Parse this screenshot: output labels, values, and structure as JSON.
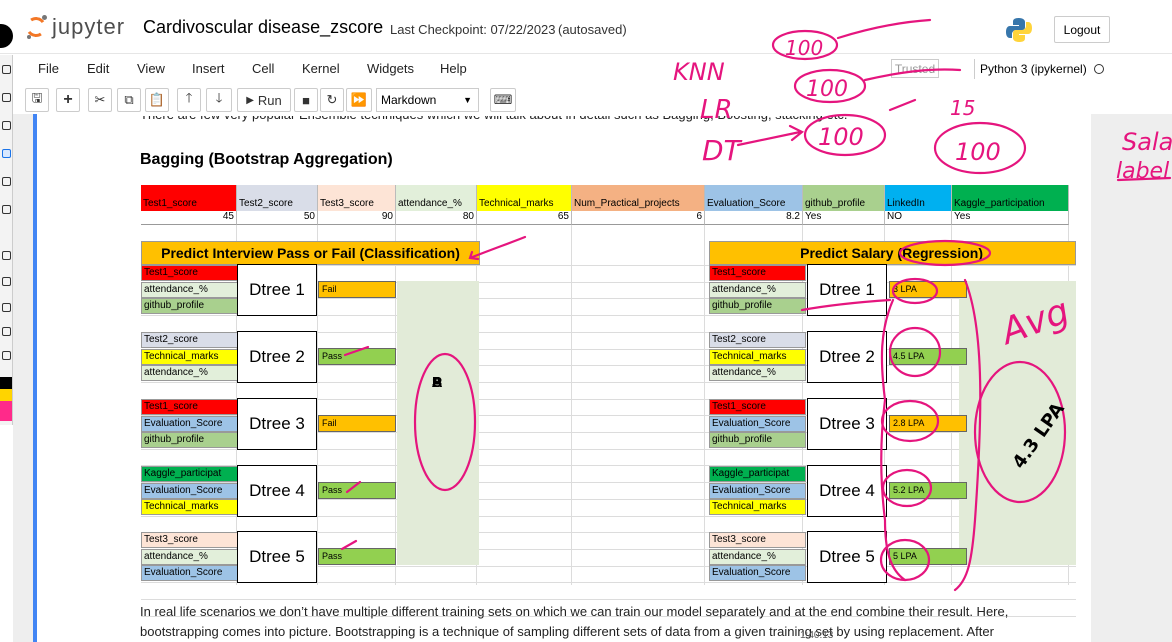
{
  "header": {
    "logo_text": "jupyter",
    "notebook_title": "Cardivoscular disease_zscore",
    "checkpoint": "Last Checkpoint: 07/22/2023",
    "autosave": "(autosaved)",
    "logout": "Logout"
  },
  "menu": [
    "File",
    "Edit",
    "View",
    "Insert",
    "Cell",
    "Kernel",
    "Widgets",
    "Help"
  ],
  "trusted": "Trusted",
  "kernel": "Python 3 (ipykernel)",
  "toolbar": {
    "run": "Run",
    "cell_type": "Markdown"
  },
  "content": {
    "intro": "There are few very popular Ensemble techniques which we will talk about in detail such as Bagging, Boosting, stacking etc.",
    "heading": "Bagging (Bootstrap Aggregation)",
    "para1": "In real life scenarios we don’t have multiple different training sets on which we can train our model separately and at the end combine their result. Here,",
    "para2": "bootstrapping comes into picture. Bootstrapping is a technique of sampling different sets of data from a given training set by using replacement. After"
  },
  "table": {
    "headers": [
      {
        "label": "Test1_score",
        "color": "#ff0000"
      },
      {
        "label": "Test2_score",
        "color": "#d9dde8"
      },
      {
        "label": "Test3_score",
        "color": "#fde4d6"
      },
      {
        "label": "attendance_%",
        "color": "#e2efda"
      },
      {
        "label": "Technical_marks",
        "color": "#ffff00"
      },
      {
        "label": "Num_Practical_projects",
        "color": "#f4b183"
      },
      {
        "label": "Evaluation_Score",
        "color": "#9dc3e6"
      },
      {
        "label": "github_profile",
        "color": "#a9d08e"
      },
      {
        "label": "LinkedIn",
        "color": "#00b0f0"
      },
      {
        "label": "Kaggle_participation",
        "color": "#00b050"
      }
    ],
    "values": [
      "45",
      "50",
      "90",
      "80",
      "65",
      "6",
      "8.2",
      "Yes",
      "NO",
      "Yes"
    ],
    "classification": {
      "title": "Predict Interview Pass or Fail (Classification)",
      "trees": [
        {
          "name": "Dtree 1",
          "features": [
            "Test1_score",
            "attendance_%",
            "github_profile"
          ],
          "result": "Fail"
        },
        {
          "name": "Dtree 2",
          "features": [
            "Test2_score",
            "Technical_marks",
            "attendance_%"
          ],
          "result": "Pass"
        },
        {
          "name": "Dtree 3",
          "features": [
            "Test1_score",
            "Evaluation_Score",
            "github_profile"
          ],
          "result": "Fail"
        },
        {
          "name": "Dtree 4",
          "features": [
            "Kaggle_participat",
            "Evaluation_Score",
            "Technical_marks"
          ],
          "result": "Pass"
        },
        {
          "name": "Dtree 5",
          "features": [
            "Test3_score",
            "attendance_%",
            "Evaluation_Score"
          ],
          "result": "Pass"
        }
      ],
      "final": [
        "P",
        "A",
        "S",
        "S"
      ]
    },
    "regression": {
      "title": "Predict Salary (Regression)",
      "trees": [
        {
          "name": "Dtree 1",
          "features": [
            "Test1_score",
            "attendance_%",
            "github_profile"
          ],
          "result": "3 LPA"
        },
        {
          "name": "Dtree 2",
          "features": [
            "Test2_score",
            "Technical_marks",
            "attendance_%"
          ],
          "result": "4.5 LPA"
        },
        {
          "name": "Dtree 3",
          "features": [
            "Test1_score",
            "Evaluation_Score",
            "github_profile"
          ],
          "result": "2.8 LPA"
        },
        {
          "name": "Dtree 4",
          "features": [
            "Kaggle_participat",
            "Evaluation_Score",
            "Technical_marks"
          ],
          "result": "5.2 LPA"
        },
        {
          "name": "Dtree 5",
          "features": [
            "Test3_score",
            "attendance_%",
            "Evaluation_Score"
          ],
          "result": "5 LPA"
        }
      ]
    }
  },
  "annotations": {
    "knn": "KNN",
    "lr": "LR",
    "dt": "DT",
    "h1": "100",
    "h2": "100",
    "h3": "100",
    "h4": "100",
    "fifteen": "15",
    "avg": "Avg",
    "avg_value": "4.3 LPA",
    "sala": "Sala",
    "label": "label"
  },
  "timestamp": "1:40:13"
}
